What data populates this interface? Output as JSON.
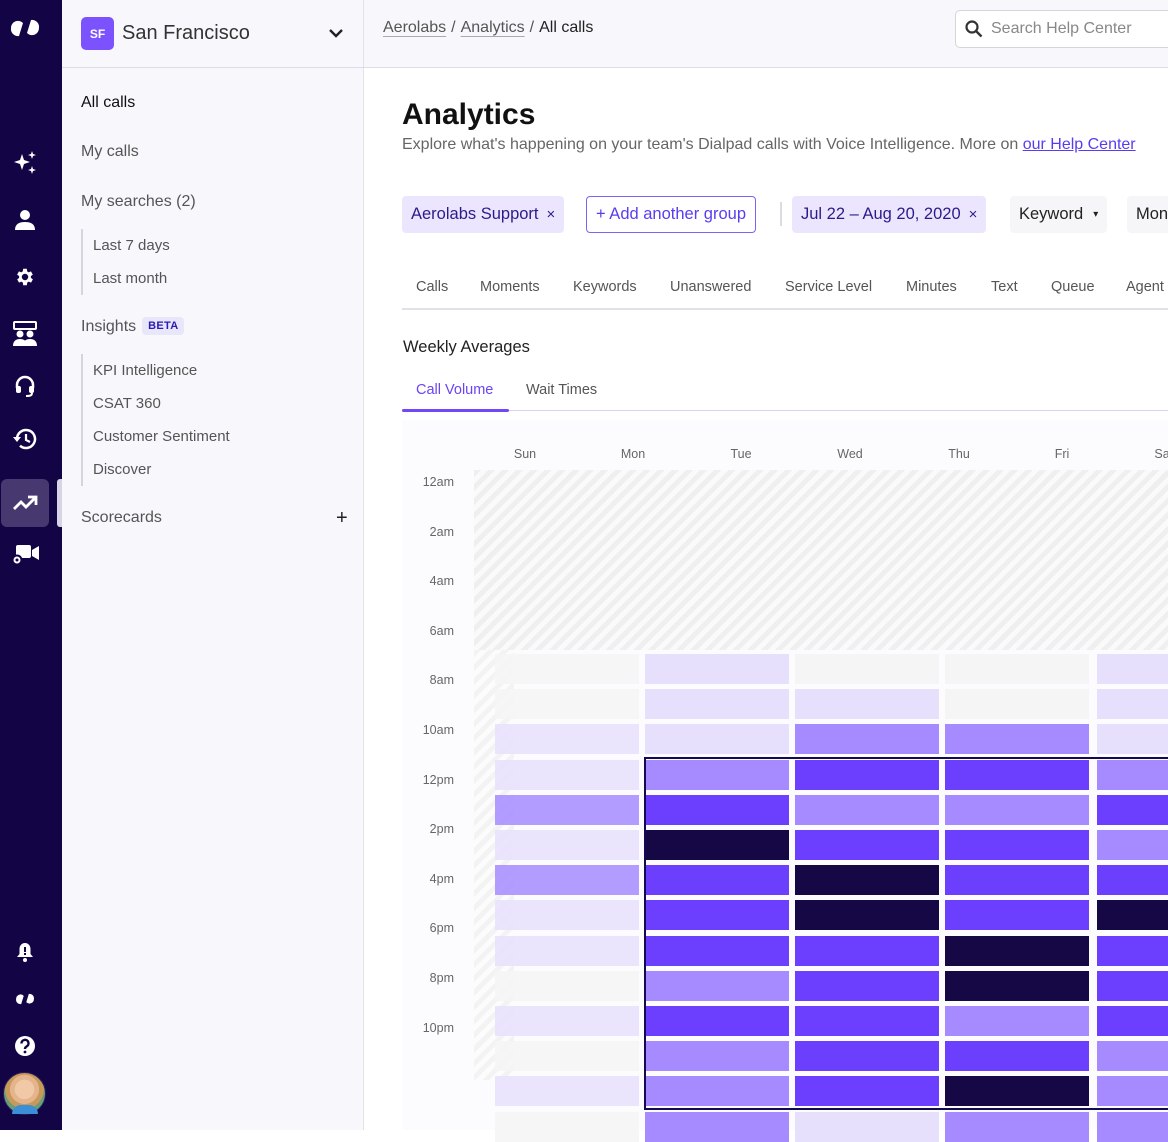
{
  "rail": {
    "icons": [
      "dialpad-logo-icon",
      "ai-sparkle-icon",
      "contacts-icon",
      "settings-icon",
      "meeting-room-icon",
      "headset-icon",
      "history-icon",
      "analytics-icon",
      "video-settings-icon",
      "notifications-icon",
      "dialpad-apps-icon",
      "help-icon"
    ],
    "active": "analytics-icon"
  },
  "workspace": {
    "badge": "SF",
    "name": "San Francisco"
  },
  "sidebar": {
    "all_calls": "All calls",
    "my_calls": "My calls",
    "my_searches": "My searches (2)",
    "searches": [
      "Last 7 days",
      "Last month"
    ],
    "insights": "Insights",
    "insights_badge": "BETA",
    "insight_items": [
      "KPI Intelligence",
      "CSAT 360",
      "Customer Sentiment",
      "Discover"
    ],
    "scorecards": "Scorecards",
    "add_label": "+"
  },
  "breadcrumb": {
    "items": [
      "Aerolabs",
      "Analytics"
    ],
    "current": "All calls",
    "separator": "/"
  },
  "search": {
    "placeholder": "Search Help Center"
  },
  "page": {
    "title": "Analytics",
    "description": "Explore what's happening on your team's Dialpad calls with Voice Intelligence. More on ",
    "help_link": "our Help Center"
  },
  "filters": {
    "group": "Aerolabs Support",
    "add_group": "+ Add another group",
    "date_range": "Jul 22 – Aug 20, 2020",
    "keyword": "Keyword",
    "more": "Mon",
    "remove": "×",
    "dropdown": "▾"
  },
  "tabs": [
    "Calls",
    "Moments",
    "Keywords",
    "Unanswered",
    "Service Level",
    "Minutes",
    "Text",
    "Queue",
    "Agent"
  ],
  "section": {
    "title": "Weekly Averages",
    "subtabs": [
      "Call Volume",
      "Wait Times"
    ],
    "active_subtab": "Call Volume"
  },
  "chart_data": {
    "type": "heatmap",
    "title": "Weekly Averages — Call Volume",
    "x_labels": [
      "Sun",
      "Mon",
      "Tue",
      "Wed",
      "Thu",
      "Fri",
      "Sa"
    ],
    "y_labels": [
      "12am",
      "2am",
      "4am",
      "6am",
      "8am",
      "10am",
      "12pm",
      "2pm",
      "4pm",
      "6pm",
      "8pm",
      "10pm"
    ],
    "no_data_range": "12am–7am",
    "intensity_scale": [
      "#f5f5f6",
      "#e6e0fc",
      "#a58bff",
      "#6c3ffe",
      "#150845"
    ],
    "cell_columns": [
      "Sun",
      "Mon",
      "Tue",
      "Wed",
      "Thu"
    ],
    "rows": [
      [
        0,
        1,
        0,
        0,
        1
      ],
      [
        0,
        1,
        1,
        0,
        1
      ],
      [
        1,
        1,
        2,
        2,
        1
      ],
      [
        1,
        2,
        3,
        3,
        2
      ],
      [
        2,
        3,
        2,
        2,
        3
      ],
      [
        1,
        4,
        3,
        3,
        2
      ],
      [
        2,
        3,
        4,
        3,
        3
      ],
      [
        1,
        3,
        4,
        3,
        4
      ],
      [
        1,
        3,
        3,
        4,
        3
      ],
      [
        0,
        2,
        3,
        4,
        3
      ],
      [
        1,
        3,
        3,
        2,
        3
      ],
      [
        0,
        2,
        3,
        3,
        2
      ],
      [
        1,
        2,
        3,
        4,
        2
      ],
      [
        0,
        2,
        1,
        2,
        2
      ]
    ],
    "selection": {
      "from_column": "Mon",
      "to_column": "Thu",
      "from_row": 3,
      "to_row": 12
    }
  }
}
